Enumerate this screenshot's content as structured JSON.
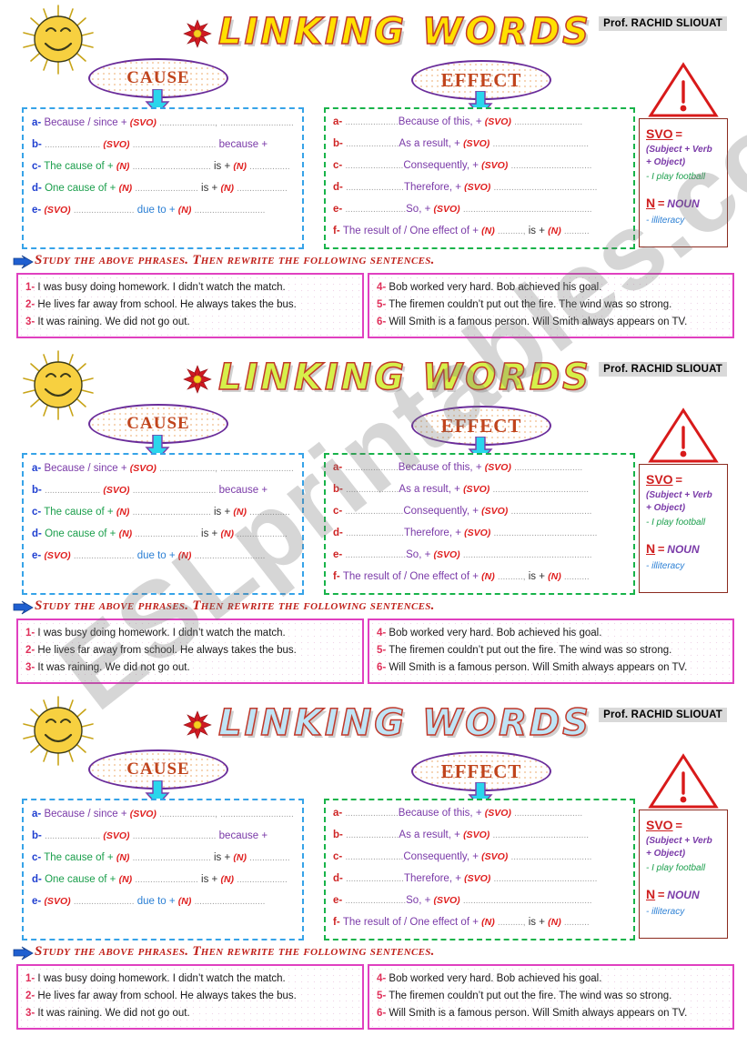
{
  "document": {
    "title": "LINKING WORDS",
    "author_badge": "Prof. RACHID SLIOUAT",
    "watermark": "ESLprintables.com",
    "copies": 3,
    "title_colors": [
      "#ffe000",
      "#d6f04a",
      "#bfe4f5"
    ],
    "accent_colors": {
      "cause_border": "#36a3e8",
      "effect_border": "#18b34a",
      "ellipse_border": "#6a2c9a",
      "ellipse_text": "#c0441d",
      "sentence_box_border": "#e040c0",
      "legend_border": "#8b2b1f",
      "warning_red": "#d81a1a",
      "instruction_red": "#c0201a"
    }
  },
  "labels": {
    "cause": "CAUSE",
    "effect": "EFFECT"
  },
  "cause_box": {
    "lines": [
      {
        "key": "a-",
        "p1": "Because / since +",
        "tag1": "(SVO)",
        "dots1": "......................,",
        "mid": "",
        "tag2": "",
        "dots2": "............................."
      },
      {
        "key": "b-",
        "p1": "",
        "dots0": "......................",
        "mid": "because +",
        "tag1": "(SVO)",
        "dots1": "................................."
      },
      {
        "key": "c-",
        "p1": "The cause of +",
        "tag1": "(N)",
        "dots1": "...............................",
        "mid": "is +",
        "tag2": "(N)",
        "dots2": "................"
      },
      {
        "key": "d-",
        "p1": "One cause of +",
        "tag1": "(N)",
        "dots1": ".........................",
        "mid": "is +",
        "tag2": "(N)",
        "dots2": "...................."
      },
      {
        "key": "e-",
        "p1": "",
        "tag1": "(SVO)",
        "dots1": "........................",
        "mid": "due to +",
        "tag2": "(N)",
        "dots2": "............................"
      }
    ]
  },
  "effect_box": {
    "lines": [
      {
        "key": "a-",
        "dots0": ".....................",
        "conn": "Because of this, +",
        "tag": "(SVO)",
        "dots1": "..........................."
      },
      {
        "key": "b-",
        "dots0": ".....................",
        "conn": "As a result, +",
        "tag": "(SVO)",
        "dots1": "......................................"
      },
      {
        "key": "c-",
        "dots0": ".......................",
        "conn": "Consequently, +",
        "tag": "(SVO)",
        "dots1": "................................"
      },
      {
        "key": "d-",
        "dots0": ".......................",
        "conn": "Therefore, +",
        "tag": "(SVO)",
        "dots1": "........................................."
      },
      {
        "key": "e-",
        "dots0": "........................",
        "conn": "So, +",
        "tag": "(SVO)",
        "dots1": "..................................................."
      },
      {
        "key": "f-",
        "conn": "The result of / One effect of +",
        "tag": "(N)",
        "dots1": "..........,",
        "mid": "is +",
        "tag2": "(N)",
        "dots2": ".........."
      }
    ]
  },
  "legend": {
    "svo_abbr": "SVO",
    "equals": "=",
    "svo_expansion_1": "(Subject + Verb",
    "svo_expansion_2": "+ Object)",
    "svo_example": "- I play football",
    "n_abbr": "N",
    "n_equals": "=",
    "n_word": "NOUN",
    "n_example": "- illiteracy"
  },
  "instruction": "Study the above phrases. Then rewrite the following sentences.",
  "sentences_left": [
    {
      "num": "1-",
      "text": "I was busy doing homework. I didn’t watch the match."
    },
    {
      "num": "2-",
      "text": "He lives far away from school. He always takes the bus."
    },
    {
      "num": "3-",
      "text": "It was raining. We did not go out."
    }
  ],
  "sentences_right": [
    {
      "num": "4-",
      "text": "Bob worked very hard. Bob achieved his goal."
    },
    {
      "num": "5-",
      "text": "The firemen couldn’t put out the fire. The wind was so strong."
    },
    {
      "num": "6-",
      "text": "Will Smith is a famous person. Will Smith always appears on TV."
    }
  ],
  "icons": {
    "sun": "sun-smiley-icon",
    "flower": "red-flower-icon",
    "warning": "warning-triangle-icon",
    "arrow_down": "down-arrow-icon",
    "bullet_arrow": "blue-arrow-bullet-icon"
  }
}
